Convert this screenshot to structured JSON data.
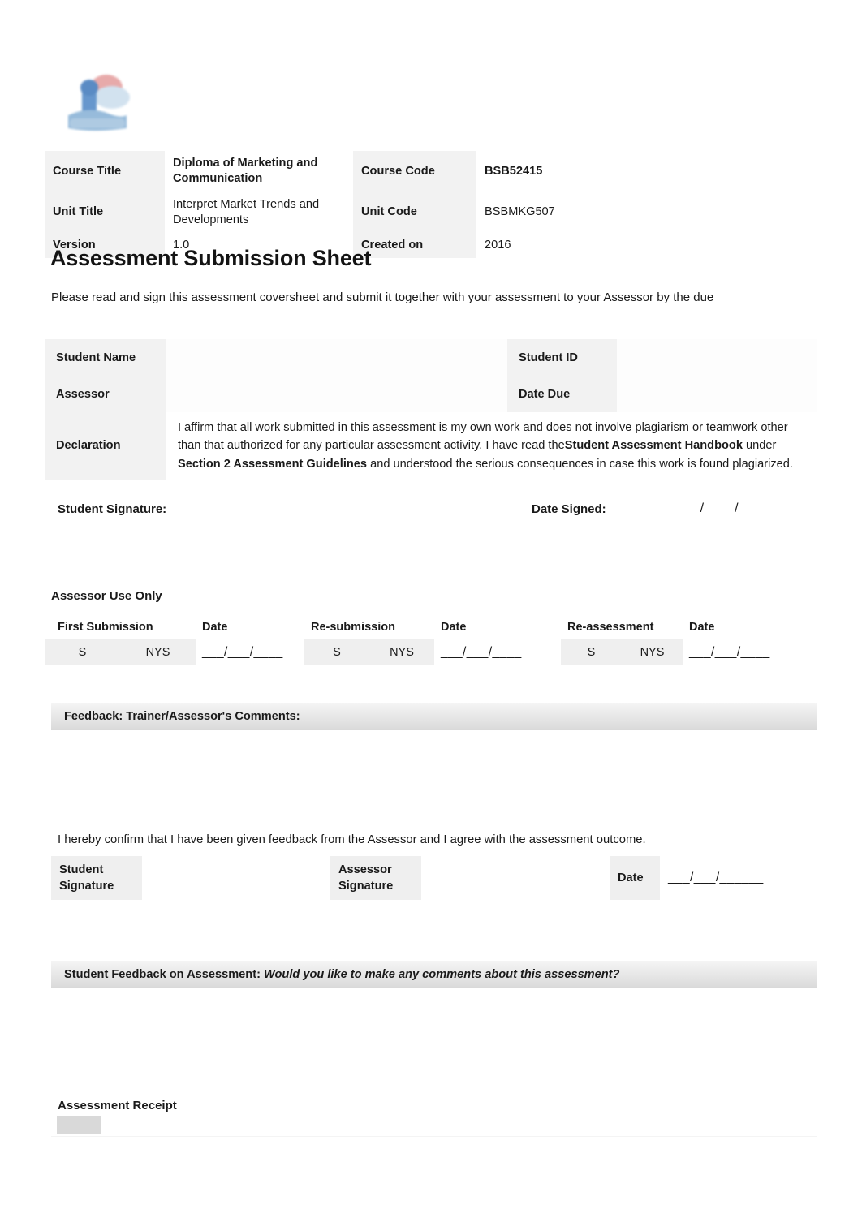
{
  "logo": {
    "name": "institution-logo",
    "colors": {
      "blue": "#5b8fc9",
      "light_blue": "#9cc0e0",
      "red": "#e09a9a"
    }
  },
  "course_header": {
    "rows": [
      {
        "label": "Course Title",
        "value": "Diploma of Marketing and Communication",
        "label2": "Course Code",
        "value2": "BSB52415"
      },
      {
        "label": "Unit Title",
        "value": "Interpret Market Trends and Developments",
        "label2": "Unit Code",
        "value2": "BSBMKG507"
      },
      {
        "label": "Version",
        "value": "1.0",
        "label2": "Created on",
        "value2": "2016"
      }
    ]
  },
  "title": "Assessment Submission Sheet",
  "intro": "Please read and sign this assessment coversheet and submit it together with your assessment to your Assessor by the due",
  "student_table": {
    "student_name_label": "Student Name",
    "student_name_value": "",
    "student_id_label": "Student ID",
    "student_id_value": "",
    "assessor_label": "Assessor",
    "assessor_value": "",
    "date_due_label": "Date Due",
    "date_due_value": "",
    "declaration_label": "Declaration",
    "declaration_p1": "I affirm that all work submitted in this assessment is my own work and does not involve plagiarism or teamwork other than that authorized for any particular assessment activity. I have read the",
    "declaration_b1": "Student Assessment Handbook",
    "declaration_p2": " under ",
    "declaration_b2": "Section 2 Assessment Guidelines",
    "declaration_p3": " and understood the serious consequences in case this work is found plagiarized."
  },
  "signature_row": {
    "student_signature_label": "Student Signature:",
    "date_signed_label": "Date Signed:",
    "date_blank": "____/____/____"
  },
  "assessor_section": {
    "heading": "Assessor Use Only",
    "columns": [
      {
        "title": "First Submission",
        "date_label": "Date"
      },
      {
        "title": "Re-submission",
        "date_label": "Date"
      },
      {
        "title": "Re-assessment",
        "date_label": "Date"
      }
    ],
    "satisfactory": "S",
    "not_yet_satisfactory": "NYS",
    "date_blank": "___/___/____"
  },
  "feedback_section": {
    "header": "Feedback: Trainer/Assessor's Comments:",
    "body_text": "",
    "confirmation": "I hereby confirm that I have been given feedback from the Assessor and I agree with the assessment outcome.",
    "student_signature_label": "Student\nSignature",
    "student_signature_line1": "Student",
    "student_signature_line2": "Signature",
    "assessor_signature_line1": "Assessor",
    "assessor_signature_line2": "Signature",
    "date_label": "Date",
    "date_blank": "___/___/______"
  },
  "student_feedback_section": {
    "header_bold": "Student Feedback on Assessment:",
    "header_italic": " Would you like to make any comments about this assessment?",
    "body_text": ""
  },
  "receipt_section": {
    "heading": "Assessment Receipt"
  }
}
